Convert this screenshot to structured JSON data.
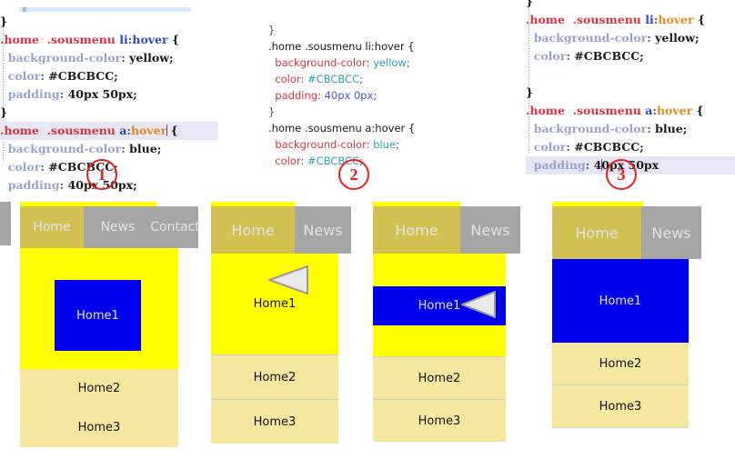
{
  "editors": [
    {
      "id": "editor-1",
      "theme": "serif",
      "lines": [
        {
          "tokens": [
            {
              "t": "}",
              "c": "t-brace"
            }
          ]
        },
        {
          "tokens": [
            {
              "t": ".home  .sousmenu ",
              "c": "t-sel"
            },
            {
              "t": "li",
              "c": "t-tag"
            },
            {
              "t": ":",
              "c": "t-punc"
            },
            {
              "t": "hover",
              "c": "t-tag"
            },
            {
              "t": " {",
              "c": "t-brace"
            }
          ]
        },
        {
          "tokens": [
            {
              "t": "  background-color",
              "c": "t-prop"
            },
            {
              "t": ": ",
              "c": "t-punc"
            },
            {
              "t": "yellow;",
              "c": "t-val"
            }
          ]
        },
        {
          "tokens": [
            {
              "t": "  color",
              "c": "t-prop"
            },
            {
              "t": ": ",
              "c": "t-punc"
            },
            {
              "t": "#CBCBCC;",
              "c": "t-val"
            }
          ]
        },
        {
          "tokens": [
            {
              "t": "  padding",
              "c": "t-prop"
            },
            {
              "t": ": ",
              "c": "t-punc"
            },
            {
              "t": "40px 50px;",
              "c": "t-val"
            }
          ]
        },
        {
          "tokens": [
            {
              "t": "}",
              "c": "t-brace"
            }
          ]
        },
        {
          "highlight": true,
          "caret_after": 4,
          "tokens": [
            {
              "t": ".home  .sousmenu ",
              "c": "t-sel"
            },
            {
              "t": "a",
              "c": "t-tag"
            },
            {
              "t": ":",
              "c": "t-punc"
            },
            {
              "t": "hove",
              "c": "t-pseudo"
            },
            {
              "t": "r",
              "c": "t-pseudo"
            },
            {
              "t": " {",
              "c": "t-brace"
            }
          ]
        },
        {
          "tokens": [
            {
              "t": "  background-color",
              "c": "t-prop"
            },
            {
              "t": ": ",
              "c": "t-punc"
            },
            {
              "t": "blue;",
              "c": "t-val"
            }
          ]
        },
        {
          "tokens": [
            {
              "t": "  color",
              "c": "t-prop"
            },
            {
              "t": ": ",
              "c": "t-punc"
            },
            {
              "t": "#CBCBCC;",
              "c": "t-val"
            }
          ]
        },
        {
          "tokens": [
            {
              "t": "  padding",
              "c": "t-prop"
            },
            {
              "t": ": ",
              "c": "t-punc"
            },
            {
              "t": "40px 50px;",
              "c": "t-val"
            }
          ]
        }
      ]
    },
    {
      "id": "editor-2",
      "theme": "sans",
      "lines": [
        {
          "tokens": [
            {
              "t": "}",
              "c": "s-punc"
            }
          ]
        },
        {
          "tokens": [
            {
              "t": ".home .sousmenu li:hover {",
              "c": "s-sel"
            }
          ]
        },
        {
          "tokens": [
            {
              "t": "  background-color",
              "c": "s-prop"
            },
            {
              "t": ": ",
              "c": "s-punc"
            },
            {
              "t": "yellow",
              "c": "s-val"
            },
            {
              "t": ";",
              "c": "s-punc"
            }
          ]
        },
        {
          "tokens": [
            {
              "t": "  color",
              "c": "s-prop"
            },
            {
              "t": ": ",
              "c": "s-punc"
            },
            {
              "t": "#CBCBCC",
              "c": "s-val"
            },
            {
              "t": ";",
              "c": "s-punc"
            }
          ]
        },
        {
          "tokens": [
            {
              "t": "  padding",
              "c": "s-prop"
            },
            {
              "t": ": ",
              "c": "s-punc"
            },
            {
              "t": "40px 0px",
              "c": "s-num"
            },
            {
              "t": ";",
              "c": "s-punc"
            }
          ]
        },
        {
          "tokens": [
            {
              "t": "}",
              "c": "s-punc"
            }
          ]
        },
        {
          "tokens": [
            {
              "t": ".home .sousmenu a:hover {",
              "c": "s-sel"
            }
          ]
        },
        {
          "tokens": [
            {
              "t": "  background-color",
              "c": "s-prop"
            },
            {
              "t": ": ",
              "c": "s-punc"
            },
            {
              "t": "blue",
              "c": "s-val"
            },
            {
              "t": ";",
              "c": "s-punc"
            }
          ]
        },
        {
          "tokens": [
            {
              "t": "  color",
              "c": "s-prop"
            },
            {
              "t": ": ",
              "c": "s-punc"
            },
            {
              "t": "#CBCBCC",
              "c": "s-val"
            },
            {
              "t": ";",
              "c": "s-punc"
            }
          ]
        }
      ]
    },
    {
      "id": "editor-3",
      "theme": "serif",
      "lines": [
        {
          "tokens": [
            {
              "t": "}",
              "c": "t-brace"
            }
          ]
        },
        {
          "tokens": [
            {
              "t": ".home  .sousmenu ",
              "c": "t-sel"
            },
            {
              "t": "li",
              "c": "t-tag"
            },
            {
              "t": ":",
              "c": "t-punc"
            },
            {
              "t": "hover",
              "c": "t-pseudo"
            },
            {
              "t": " {",
              "c": "t-brace"
            }
          ]
        },
        {
          "tokens": [
            {
              "t": "  background-color",
              "c": "t-prop"
            },
            {
              "t": ": ",
              "c": "t-punc"
            },
            {
              "t": "yellow;",
              "c": "t-val"
            }
          ]
        },
        {
          "tokens": [
            {
              "t": "  color",
              "c": "t-prop"
            },
            {
              "t": ": ",
              "c": "t-punc"
            },
            {
              "t": "#CBCBCC;",
              "c": "t-val"
            }
          ]
        },
        {
          "tokens": [
            {
              "t": "",
              "c": "t-val"
            }
          ]
        },
        {
          "tokens": [
            {
              "t": "}",
              "c": "t-brace"
            }
          ]
        },
        {
          "tokens": [
            {
              "t": ".home  .sousmenu ",
              "c": "t-sel"
            },
            {
              "t": "a",
              "c": "t-tag"
            },
            {
              "t": ":",
              "c": "t-punc"
            },
            {
              "t": "hover",
              "c": "t-pseudo"
            },
            {
              "t": " {",
              "c": "t-brace"
            }
          ]
        },
        {
          "tokens": [
            {
              "t": "  background-color",
              "c": "t-prop"
            },
            {
              "t": ": ",
              "c": "t-punc"
            },
            {
              "t": "blue;",
              "c": "t-val"
            }
          ]
        },
        {
          "tokens": [
            {
              "t": "  color",
              "c": "t-prop"
            },
            {
              "t": ": ",
              "c": "t-punc"
            },
            {
              "t": "#CBCBCC;",
              "c": "t-val"
            }
          ]
        },
        {
          "highlight": true,
          "caret_after": 2,
          "tokens": [
            {
              "t": "  padding",
              "c": "t-prop"
            },
            {
              "t": ": ",
              "c": "t-punc"
            },
            {
              "t": "4",
              "c": "t-val"
            },
            {
              "t": "0px 50px",
              "c": "t-val"
            }
          ]
        }
      ]
    }
  ],
  "markers": [
    {
      "label": "1"
    },
    {
      "label": "2"
    },
    {
      "label": "3"
    }
  ],
  "previews": [
    {
      "id": "preview-1",
      "nav": [
        {
          "label": "Home",
          "state": "active"
        },
        {
          "label": "News",
          "state": "plain"
        },
        {
          "label": "Contact",
          "state": "plain"
        }
      ],
      "items": [
        {
          "label": "Home1",
          "style": "blue-box"
        },
        {
          "label": "Home2",
          "style": "light"
        },
        {
          "label": "Home3",
          "style": "light"
        }
      ],
      "cursor": false
    },
    {
      "id": "preview-2",
      "nav": [
        {
          "label": "Home",
          "state": "active"
        },
        {
          "label": "News",
          "state": "plain"
        }
      ],
      "items": [
        {
          "label": "Home1",
          "style": "yellow"
        },
        {
          "label": "Home2",
          "style": "light"
        },
        {
          "label": "Home3",
          "style": "light"
        }
      ],
      "cursor": true
    },
    {
      "id": "preview-3",
      "nav": [
        {
          "label": "Home",
          "state": "active"
        },
        {
          "label": "News",
          "state": "plain"
        }
      ],
      "items": [
        {
          "label": "Home1",
          "style": "blue-band"
        },
        {
          "label": "Home2",
          "style": "light"
        },
        {
          "label": "Home3",
          "style": "light"
        }
      ],
      "cursor": true
    },
    {
      "id": "preview-4",
      "nav": [
        {
          "label": "Home",
          "state": "active"
        },
        {
          "label": "News",
          "state": "plain"
        }
      ],
      "items": [
        {
          "label": "Home1",
          "style": "blue-full"
        },
        {
          "label": "Home2",
          "style": "light"
        },
        {
          "label": "Home3",
          "style": "light"
        }
      ],
      "cursor": false
    }
  ],
  "colors": {
    "yellow": "#ffff00",
    "light_yellow": "#f5e79e",
    "blue": "#0000ee",
    "nav_active": "#d0c152",
    "nav_plain": "#a6a6a6",
    "nav_text": "#CBCBCC",
    "marker_red": "#ef1d1d",
    "highlight_line": "#e6e6f5"
  }
}
